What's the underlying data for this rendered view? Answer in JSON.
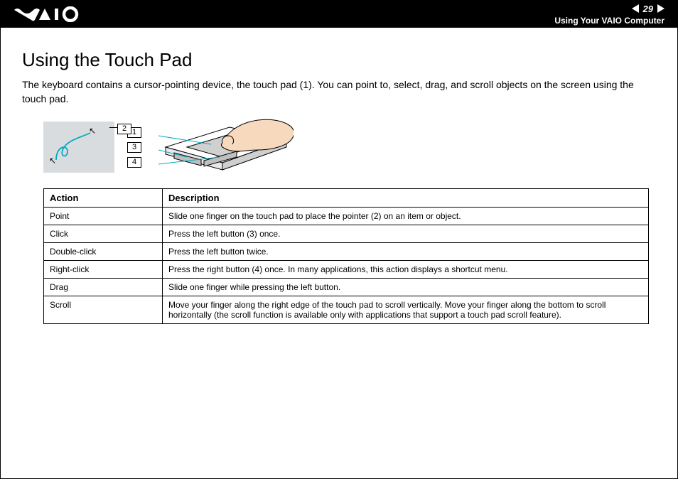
{
  "header": {
    "page_number": "29",
    "section": "Using Your VAIO Computer"
  },
  "title": "Using the Touch Pad",
  "intro": "The keyboard contains a cursor-pointing device, the touch pad (1). You can point to, select, drag, and scroll objects on the screen using the touch pad.",
  "callouts": {
    "c1": "1",
    "c2": "2",
    "c3": "3",
    "c4": "4"
  },
  "table": {
    "headers": {
      "action": "Action",
      "description": "Description"
    },
    "rows": [
      {
        "action": "Point",
        "description": "Slide one finger on the touch pad to place the pointer (2) on an item or object."
      },
      {
        "action": "Click",
        "description": "Press the left button (3) once."
      },
      {
        "action": "Double-click",
        "description": "Press the left button twice."
      },
      {
        "action": "Right-click",
        "description": "Press the right button (4) once. In many applications, this action displays a shortcut menu."
      },
      {
        "action": "Drag",
        "description": "Slide one finger while pressing the left button."
      },
      {
        "action": "Scroll",
        "description": "Move your finger along the right edge of the touch pad to scroll vertically. Move your finger along the bottom to scroll horizontally (the scroll function is available only with applications that support a touch pad scroll feature)."
      }
    ]
  }
}
